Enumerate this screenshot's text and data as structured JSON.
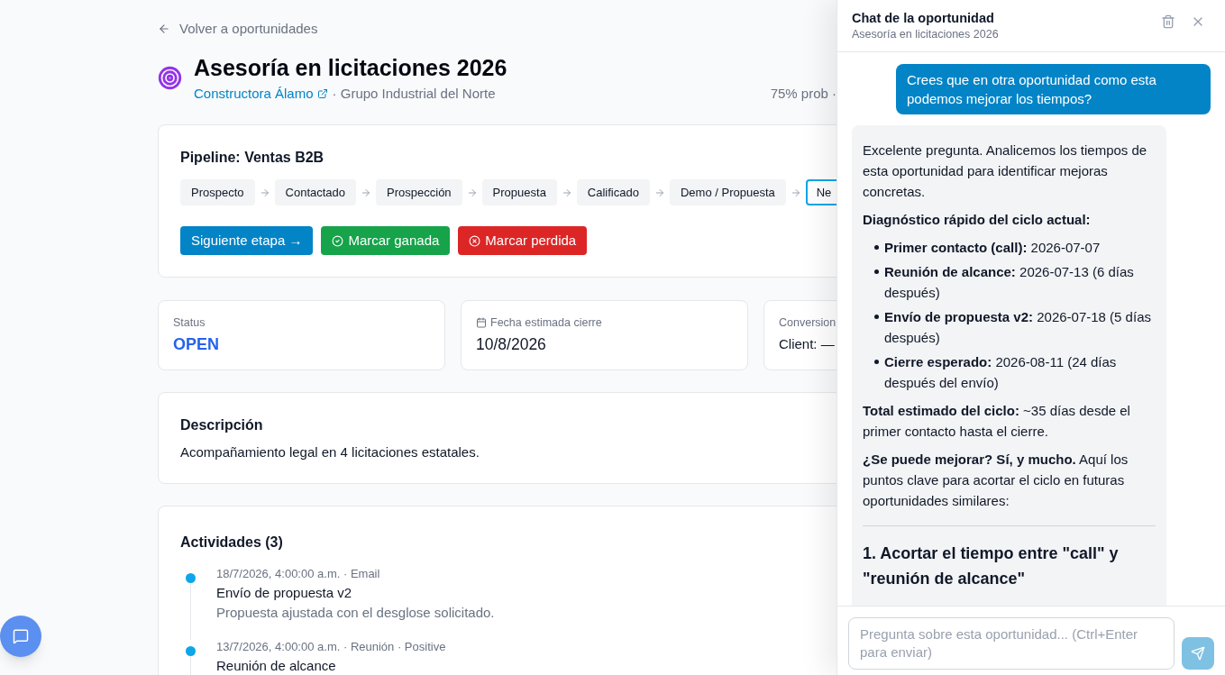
{
  "back_link": "Volver a oportunidades",
  "header": {
    "title": "Asesoría en licitaciones 2026",
    "company_link": "Constructora Álamo",
    "group": "· Grupo Industrial del Norte",
    "probability": "75% prob ·"
  },
  "pipeline": {
    "title": "Pipeline: Ventas B2B",
    "stages": [
      {
        "label": "Prospecto",
        "selected": false
      },
      {
        "label": "Contactado",
        "selected": false
      },
      {
        "label": "Prospección",
        "selected": false
      },
      {
        "label": "Propuesta",
        "selected": false
      },
      {
        "label": "Calificado",
        "selected": false
      },
      {
        "label": "Demo / Propuesta",
        "selected": false
      },
      {
        "label": "Ne",
        "selected": true
      }
    ],
    "actions": [
      {
        "kind": "next",
        "label": "Siguiente etapa →"
      },
      {
        "kind": "won",
        "label": "Marcar ganada"
      },
      {
        "kind": "lost",
        "label": "Marcar perdida"
      }
    ]
  },
  "stats": [
    {
      "kind": "status",
      "label": "Status",
      "value": "OPEN"
    },
    {
      "kind": "date",
      "label": "Fecha estimada cierre",
      "value": "10/8/2026"
    },
    {
      "kind": "plain",
      "label": "Conversion",
      "value": "Client: —"
    }
  ],
  "description": {
    "title": "Descripción",
    "text": "Acompañamiento legal en 4 licitaciones estatales."
  },
  "activities": {
    "title": "Actividades (3)",
    "items": [
      {
        "meta": "18/7/2026, 4:00:00 a.m. · Email",
        "title": "Envío de propuesta v2",
        "body": "Propuesta ajustada con el desglose solicitado."
      },
      {
        "meta": "13/7/2026, 4:00:00 a.m. · Reunión · Positive",
        "title": "Reunión de alcance"
      }
    ]
  },
  "chat": {
    "title": "Chat de la oportunidad",
    "subtitle": "Asesoría en licitaciones 2026",
    "messages": [
      {
        "kind": "user",
        "text": "Crees que en otra oportunidad como esta podemos mejorar los tiempos?"
      },
      {
        "kind": "assistant",
        "blocks": [
          {
            "kind": "paragraph",
            "text": "Excelente pregunta. Analicemos los tiempos de esta oportunidad para identificar mejoras concretas."
          },
          {
            "kind": "label",
            "text": "Diagnóstico rápido del ciclo actual:"
          },
          {
            "kind": "list",
            "items": [
              "**Primer contacto (call):** 2026-07-07",
              "**Reunión de alcance:** 2026-07-13 (6 días después)",
              "**Envío de propuesta v2:** 2026-07-18 (5 días después)",
              "**Cierre esperado:** 2026-08-11 (24 días después del envío)"
            ]
          },
          {
            "kind": "paragraph",
            "text": "**Total estimado del ciclo:** ~35 días desde el primer contacto hasta el cierre."
          },
          {
            "kind": "paragraph",
            "text": "**¿Se puede mejorar? Sí, y mucho.** Aquí los puntos clave para acortar el ciclo en futuras oportunidades similares:"
          },
          {
            "kind": "rule"
          },
          {
            "kind": "heading",
            "text": "1. Acortar el tiempo entre \"call\" y \"reunión de alcance\""
          }
        ]
      }
    ],
    "input": {
      "placeholder": "Pregunta sobre esta oportunidad... (Ctrl+Enter para enviar)"
    },
    "send_button": {
      "disabled": true
    }
  }
}
